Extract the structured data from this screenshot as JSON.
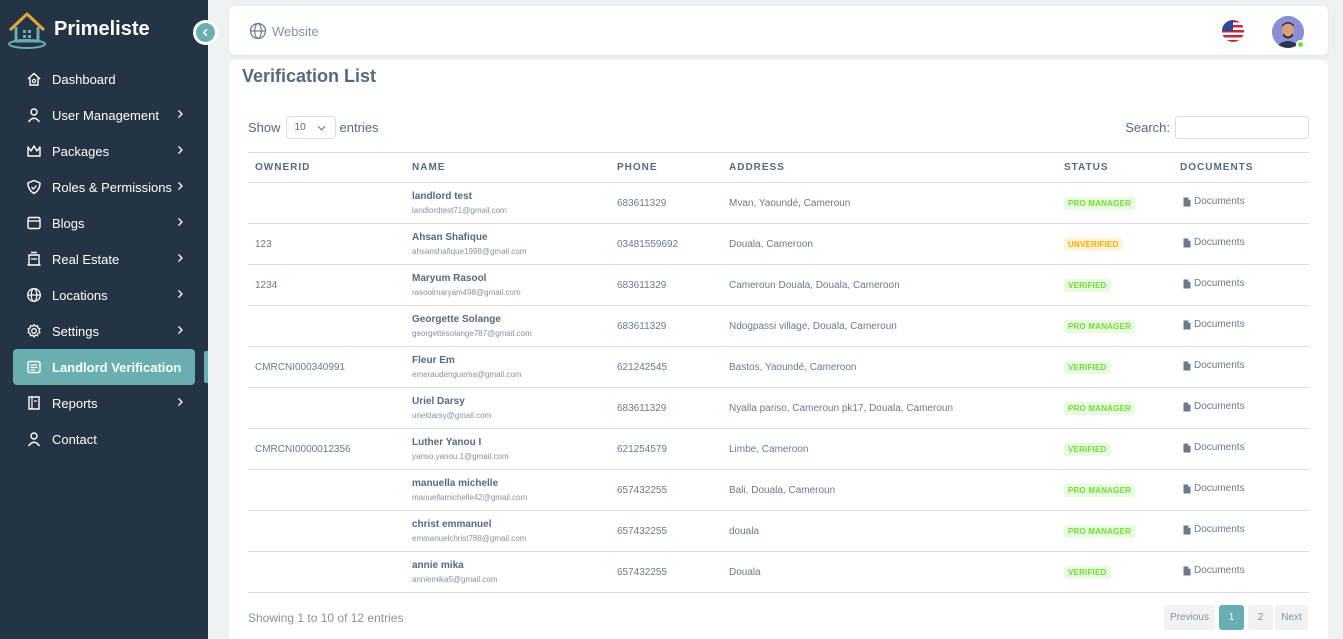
{
  "brand": {
    "name": "Primeliste"
  },
  "sidebar": {
    "items": [
      {
        "label": "Dashboard",
        "icon": "home-icon",
        "has_chevron": false
      },
      {
        "label": "User Management",
        "icon": "user-icon",
        "has_chevron": true
      },
      {
        "label": "Packages",
        "icon": "crown-icon",
        "has_chevron": true
      },
      {
        "label": "Roles & Permissions",
        "icon": "shield-icon",
        "has_chevron": true
      },
      {
        "label": "Blogs",
        "icon": "blog-icon",
        "has_chevron": true
      },
      {
        "label": "Real Estate",
        "icon": "building-icon",
        "has_chevron": true
      },
      {
        "label": "Locations",
        "icon": "globe-icon",
        "has_chevron": true
      },
      {
        "label": "Settings",
        "icon": "gear-icon",
        "has_chevron": true
      },
      {
        "label": "Landlord Verification",
        "icon": "list-icon",
        "has_chevron": false
      },
      {
        "label": "Reports",
        "icon": "report-icon",
        "has_chevron": true
      },
      {
        "label": "Contact",
        "icon": "user-icon",
        "has_chevron": false
      }
    ],
    "active_index": 8
  },
  "topbar": {
    "website_label": "Website"
  },
  "page": {
    "title": "Verification List",
    "show_label": "Show",
    "entries_label": "entries",
    "entries_value": "10",
    "search_label": "Search:"
  },
  "table": {
    "headers": [
      "OWNERID",
      "NAME",
      "PHONE",
      "ADDRESS",
      "STATUS",
      "DOCUMENTS"
    ],
    "rows": [
      {
        "ownerid": "",
        "name": "landlord test",
        "email": "landlordtest71@gmail.com",
        "phone": "683611329",
        "address": "Mvan, Yaoundé, Cameroun",
        "status": "PRO MANAGER",
        "documents": "Documents"
      },
      {
        "ownerid": "123",
        "name": "Ahsan Shafique",
        "email": "ahsanshafique1998@gmail.com",
        "phone": "03481559692",
        "address": "Douala, Cameroon",
        "status": "UNVERIFIED",
        "documents": "Documents"
      },
      {
        "ownerid": "1234",
        "name": "Maryum Rasool",
        "email": "rasoolmaryam498@gmail.com",
        "phone": "683611329",
        "address": "Cameroun Douala, Douala, Cameroon",
        "status": "VERIFIED",
        "documents": "Documents"
      },
      {
        "ownerid": "",
        "name": "Georgette Solange",
        "email": "georgettesolange787@gmail.com",
        "phone": "683611329",
        "address": "Ndogpassi village, Douala, Cameroun",
        "status": "PRO MANAGER",
        "documents": "Documents"
      },
      {
        "ownerid": "CMRCNI000340991",
        "name": "Fleur Em",
        "email": "emeraudenguema@gmail.com",
        "phone": "621242545",
        "address": "Bastos, Yaoundé, Cameroon",
        "status": "VERIFIED",
        "documents": "Documents"
      },
      {
        "ownerid": "",
        "name": "Uriel Darsy",
        "email": "urieldarsy@gmail.com",
        "phone": "683611329",
        "address": "Nyalla pariso, Cameroun pk17, Douala, Cameroun",
        "status": "PRO MANAGER",
        "documents": "Documents"
      },
      {
        "ownerid": "CMRCNI0000012356",
        "name": "Luther Yanou I",
        "email": "yanso.yanou.1@gmail.com",
        "phone": "621254579",
        "address": "Limbe, Cameroon",
        "status": "VERIFIED",
        "documents": "Documents"
      },
      {
        "ownerid": "",
        "name": "manuella michelle",
        "email": "manuellamichelle42@gmail.com",
        "phone": "657432255",
        "address": "Bali, Douala, Cameroun",
        "status": "PRO MANAGER",
        "documents": "Documents"
      },
      {
        "ownerid": "",
        "name": "christ emmanuel",
        "email": "emmanuelchrist788@gmail.com",
        "phone": "657432255",
        "address": "douala",
        "status": "PRO MANAGER",
        "documents": "Documents"
      },
      {
        "ownerid": "",
        "name": "annie mika",
        "email": "anniemika5@gmail.com",
        "phone": "657432255",
        "address": "Douala",
        "status": "VERIFIED",
        "documents": "Documents"
      }
    ]
  },
  "status_colors": {
    "PRO MANAGER": {
      "bg": "#e8fadf",
      "fg": "#71dd37"
    },
    "VERIFIED": {
      "bg": "#e8fadf",
      "fg": "#71dd37"
    },
    "UNVERIFIED": {
      "bg": "#fff2d6",
      "fg": "#ffab00"
    }
  },
  "footer": {
    "info": "Showing 1 to 10 of 12 entries",
    "previous": "Previous",
    "pages": [
      "1",
      "2"
    ],
    "current_page": "1",
    "next": "Next"
  },
  "colors": {
    "sidebar_bg": "#253444",
    "accent": "#69aeb0"
  }
}
